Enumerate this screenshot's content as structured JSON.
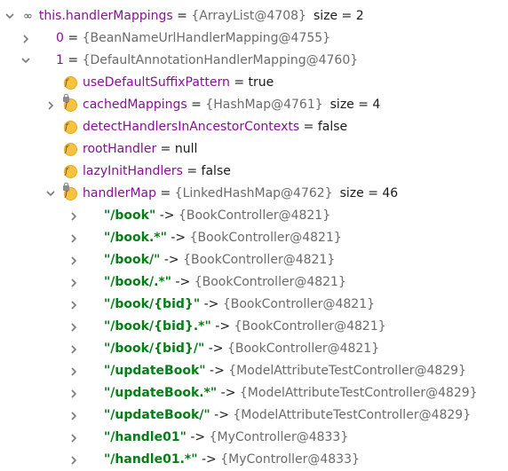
{
  "rows": [
    {
      "indent": 0,
      "arrow": "down",
      "icon": "oo",
      "name": "this.handlerMappings",
      "sep": " = ",
      "ref": "{ArrayList@4708}",
      "extra": "size = 2"
    },
    {
      "indent": 1,
      "arrow": "right",
      "icon": "list",
      "name": "0",
      "sep": " = ",
      "ref": "{BeanNameUrlHandlerMapping@4755}"
    },
    {
      "indent": 1,
      "arrow": "down",
      "icon": "list",
      "name": "1",
      "sep": " = ",
      "ref": "{DefaultAnnotationHandlerMapping@4760}"
    },
    {
      "indent": 2,
      "arrow": "none",
      "icon": "f",
      "name": "useDefaultSuffixPattern",
      "sep": " = ",
      "val": "true"
    },
    {
      "indent": 2,
      "arrow": "right",
      "icon": "f-lock",
      "name": "cachedMappings",
      "sep": " = ",
      "ref": "{HashMap@4761}",
      "extra": "size = 4"
    },
    {
      "indent": 2,
      "arrow": "none",
      "icon": "f",
      "name": "detectHandlersInAncestorContexts",
      "sep": " = ",
      "val": "false"
    },
    {
      "indent": 2,
      "arrow": "none",
      "icon": "f",
      "name": "rootHandler",
      "sep": " = ",
      "val": "null"
    },
    {
      "indent": 2,
      "arrow": "none",
      "icon": "f",
      "name": "lazyInitHandlers",
      "sep": " = ",
      "val": "false"
    },
    {
      "indent": 2,
      "arrow": "down",
      "icon": "f-lock",
      "name": "handlerMap",
      "sep": " = ",
      "ref": "{LinkedHashMap@4762}",
      "extra": "size = 46"
    },
    {
      "indent": 3,
      "arrow": "right",
      "icon": "list",
      "key": "\"/book\"",
      "sep": " -> ",
      "ref": "{BookController@4821}"
    },
    {
      "indent": 3,
      "arrow": "right",
      "icon": "list",
      "key": "\"/book.*\"",
      "sep": " -> ",
      "ref": "{BookController@4821}"
    },
    {
      "indent": 3,
      "arrow": "right",
      "icon": "list",
      "key": "\"/book/\"",
      "sep": " -> ",
      "ref": "{BookController@4821}"
    },
    {
      "indent": 3,
      "arrow": "right",
      "icon": "list",
      "key": "\"/book/.*\"",
      "sep": " -> ",
      "ref": "{BookController@4821}"
    },
    {
      "indent": 3,
      "arrow": "right",
      "icon": "list",
      "key": "\"/book/{bid}\"",
      "sep": " -> ",
      "ref": "{BookController@4821}"
    },
    {
      "indent": 3,
      "arrow": "right",
      "icon": "list",
      "key": "\"/book/{bid}.*\"",
      "sep": " -> ",
      "ref": "{BookController@4821}"
    },
    {
      "indent": 3,
      "arrow": "right",
      "icon": "list",
      "key": "\"/book/{bid}/\"",
      "sep": " -> ",
      "ref": "{BookController@4821}"
    },
    {
      "indent": 3,
      "arrow": "right",
      "icon": "list",
      "key": "\"/updateBook\"",
      "sep": " -> ",
      "ref": "{ModelAttributeTestController@4829}"
    },
    {
      "indent": 3,
      "arrow": "right",
      "icon": "list",
      "key": "\"/updateBook.*\"",
      "sep": " -> ",
      "ref": "{ModelAttributeTestController@4829}"
    },
    {
      "indent": 3,
      "arrow": "right",
      "icon": "list",
      "key": "\"/updateBook/\"",
      "sep": " -> ",
      "ref": "{ModelAttributeTestController@4829}"
    },
    {
      "indent": 3,
      "arrow": "right",
      "icon": "list",
      "key": "\"/handle01\"",
      "sep": " -> ",
      "ref": "{MyController@4833}"
    },
    {
      "indent": 3,
      "arrow": "right",
      "icon": "list",
      "key": "\"/handle01.*\"",
      "sep": " -> ",
      "ref": "{MyController@4833}"
    }
  ]
}
